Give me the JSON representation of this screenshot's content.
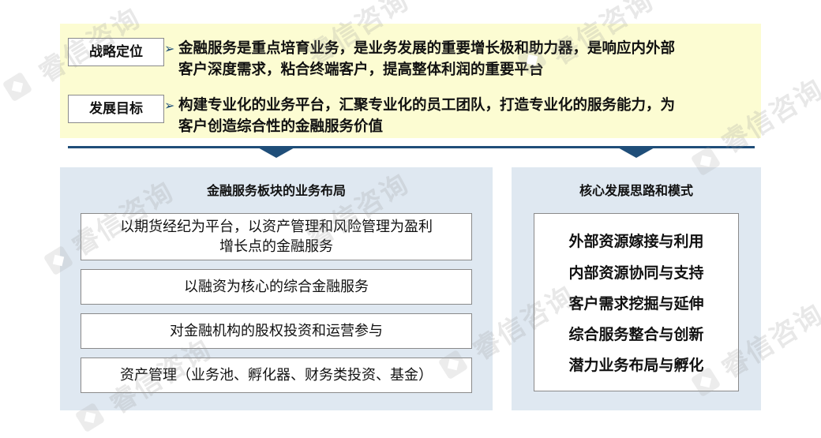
{
  "watermark": "睿信咨询",
  "strategy": {
    "positioning_label": "战略定位",
    "positioning_line1": "金融服务是重点培育业务，是业务发展的重要增长极和助力器，是响应内外部",
    "positioning_line2": "客户深度需求，粘合终端客户，提高整体利润的重要平台",
    "goal_label": "发展目标",
    "goal_line1": "构建专业化的业务平台，汇聚专业化的员工团队，打造专业化的服务能力，为",
    "goal_line2": "客户创造综合性的金融服务价值",
    "bullet": "➢"
  },
  "left_panel": {
    "title": "金融服务板块的业务布局",
    "items": [
      {
        "line1": "以期货经纪为平台，以资产管理和风险管理为盈利",
        "line2": "增长点的金融服务"
      },
      {
        "line1": "以融资为核心的综合金融服务",
        "line2": ""
      },
      {
        "line1": "对金融机构的股权投资和运营参与",
        "line2": ""
      },
      {
        "line1": "资产管理（业务池、孵化器、财务类投资、基金）",
        "line2": ""
      }
    ]
  },
  "right_panel": {
    "title": "核心发展思路和模式",
    "items": [
      "外部资源嫁接与利用",
      "内部资源协同与支持",
      "客户需求挖掘与延伸",
      "综合服务整合与创新",
      "潜力业务布局与孵化"
    ]
  },
  "colors": {
    "top_panel_bg": "#fcfcd2",
    "lower_panel_bg": "#dfe8f1",
    "divider": "#1f4e79"
  }
}
